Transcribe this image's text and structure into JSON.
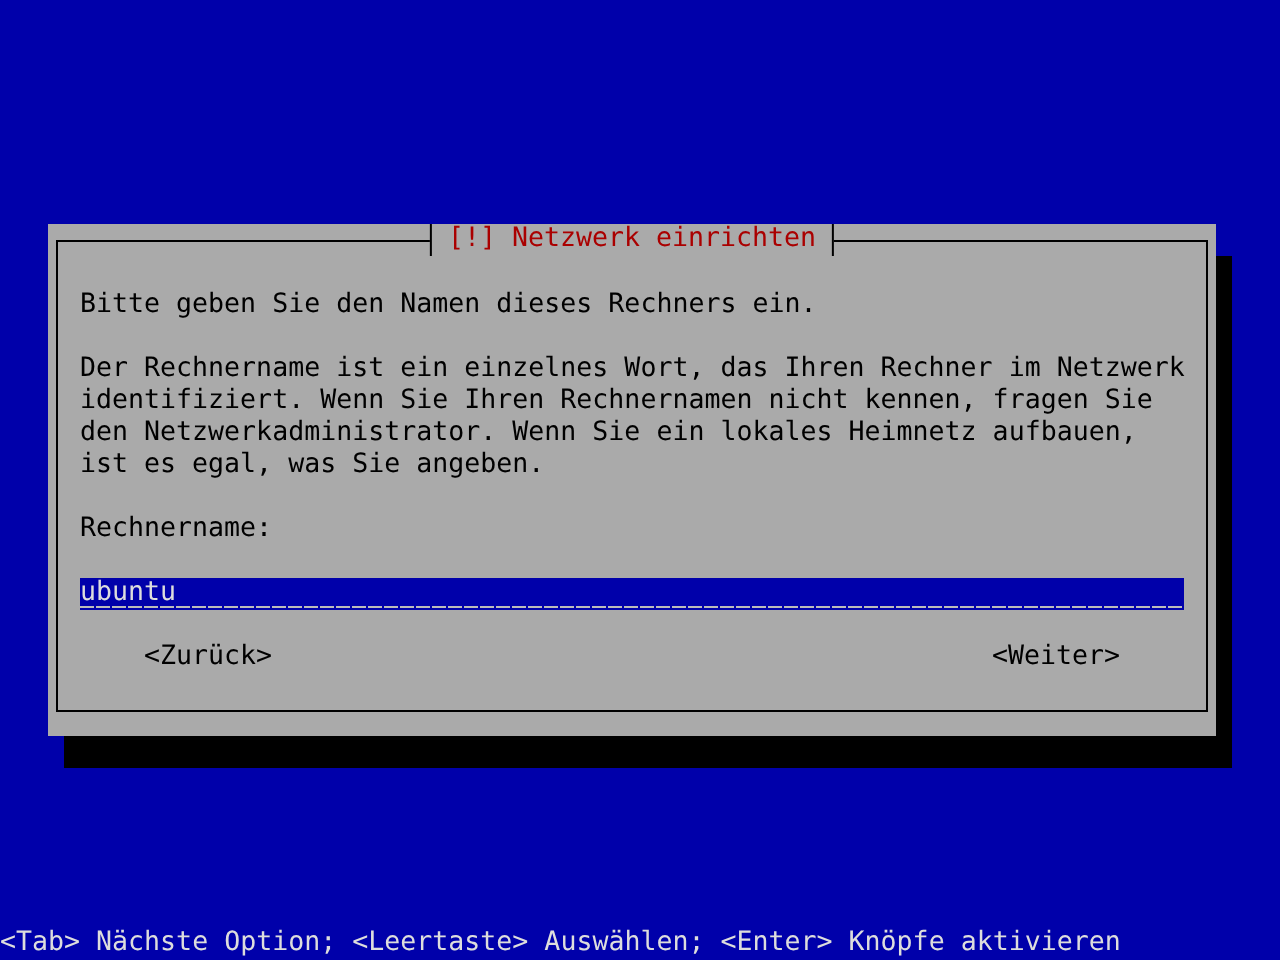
{
  "dialog": {
    "title": "[!] Netzwerk einrichten",
    "prompt": "Bitte geben Sie den Namen dieses Rechners ein.",
    "description": "Der Rechnername ist ein einzelnes Wort, das Ihren Rechner im Netzwerk identifiziert. Wenn Sie Ihren Rechnernamen nicht kennen, fragen Sie den Netzwerkadministrator. Wenn Sie ein lokales Heimnetz aufbauen, ist es egal, was Sie angeben.",
    "field": {
      "label": "Rechnername:",
      "value": "ubuntu"
    },
    "buttons": [
      {
        "label": "<Zurück>"
      },
      {
        "label": "<Weiter>"
      }
    ]
  },
  "help_bar": "<Tab> Nächste Option; <Leertaste> Auswählen; <Enter> Knöpfe aktivieren"
}
